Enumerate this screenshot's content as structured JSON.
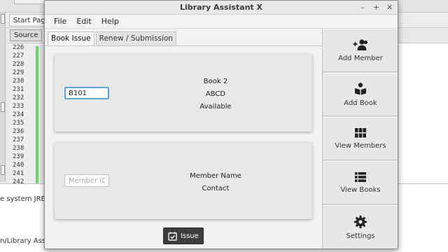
{
  "ide": {
    "start_page_tab": "Start Page",
    "source_button": "Source",
    "line_numbers": [
      "226",
      "227",
      "228",
      "229",
      "230",
      "231",
      "232",
      "233",
      "234",
      "235",
      "236",
      "237",
      "238",
      "239",
      "240",
      "241",
      "242"
    ],
    "output_line_1": "e system JRE",
    "output_line_2": "n/Library Assi"
  },
  "window": {
    "title": "Library Assistant X",
    "controls": {
      "minimize": "–",
      "maximize": "+",
      "close": "✕"
    }
  },
  "menu": {
    "items": [
      "File",
      "Edit",
      "Help"
    ]
  },
  "tabs": [
    {
      "label": "Book Issue",
      "active": true
    },
    {
      "label": "Renew / Submission",
      "active": false
    }
  ],
  "book_card": {
    "book_id_value": "B101",
    "book_name": "Book 2",
    "author": "ABCD",
    "status": "Available"
  },
  "member_card": {
    "member_id_placeholder": "Member ID",
    "member_name": "Member Name",
    "contact": "Contact"
  },
  "issue_button": {
    "label": "Issue",
    "icon": "calendar-check-icon"
  },
  "sidebar": {
    "items": [
      {
        "label": "Add Member",
        "icon": "add-user-icon"
      },
      {
        "label": "Add Book",
        "icon": "book-reader-icon"
      },
      {
        "label": "View Members",
        "icon": "grid-icon"
      },
      {
        "label": "View Books",
        "icon": "list-icon"
      },
      {
        "label": "Settings",
        "icon": "gear-icon"
      }
    ]
  },
  "colors": {
    "focus_border": "#5fa6d6",
    "issue_button_bg": "#3d3d3d",
    "ide_diff_bar": "#6fcf6f"
  }
}
